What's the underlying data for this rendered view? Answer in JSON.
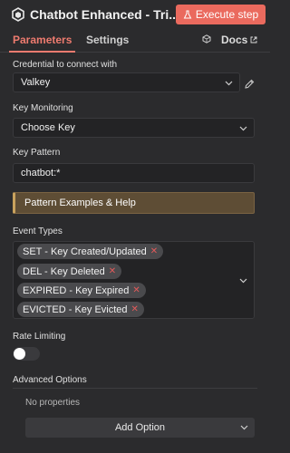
{
  "header": {
    "title": "Chatbot Enhanced - Tri...",
    "execute_label": "Execute step",
    "accent": "#ea6a5e"
  },
  "tabs": {
    "parameters": "Parameters",
    "settings": "Settings",
    "docs": "Docs"
  },
  "credential": {
    "label": "Credential to connect with",
    "value": "Valkey"
  },
  "key_monitoring": {
    "label": "Key Monitoring",
    "value": "Choose Key"
  },
  "key_pattern": {
    "label": "Key Pattern",
    "value": "chatbot:*"
  },
  "notice": {
    "text": "Pattern Examples & Help"
  },
  "event_types": {
    "label": "Event Types",
    "chips": [
      "SET - Key Created/Updated",
      "DEL - Key Deleted",
      "EXPIRED - Key Expired",
      "EVICTED - Key Evicted"
    ]
  },
  "rate_limiting": {
    "label": "Rate Limiting",
    "enabled": false
  },
  "advanced": {
    "label": "Advanced Options",
    "empty_text": "No properties",
    "add_label": "Add Option"
  },
  "icons": [
    "node-icon",
    "flask-icon",
    "cube-icon",
    "external-link-icon",
    "chevron-down-icon",
    "pencil-icon",
    "close-icon"
  ]
}
